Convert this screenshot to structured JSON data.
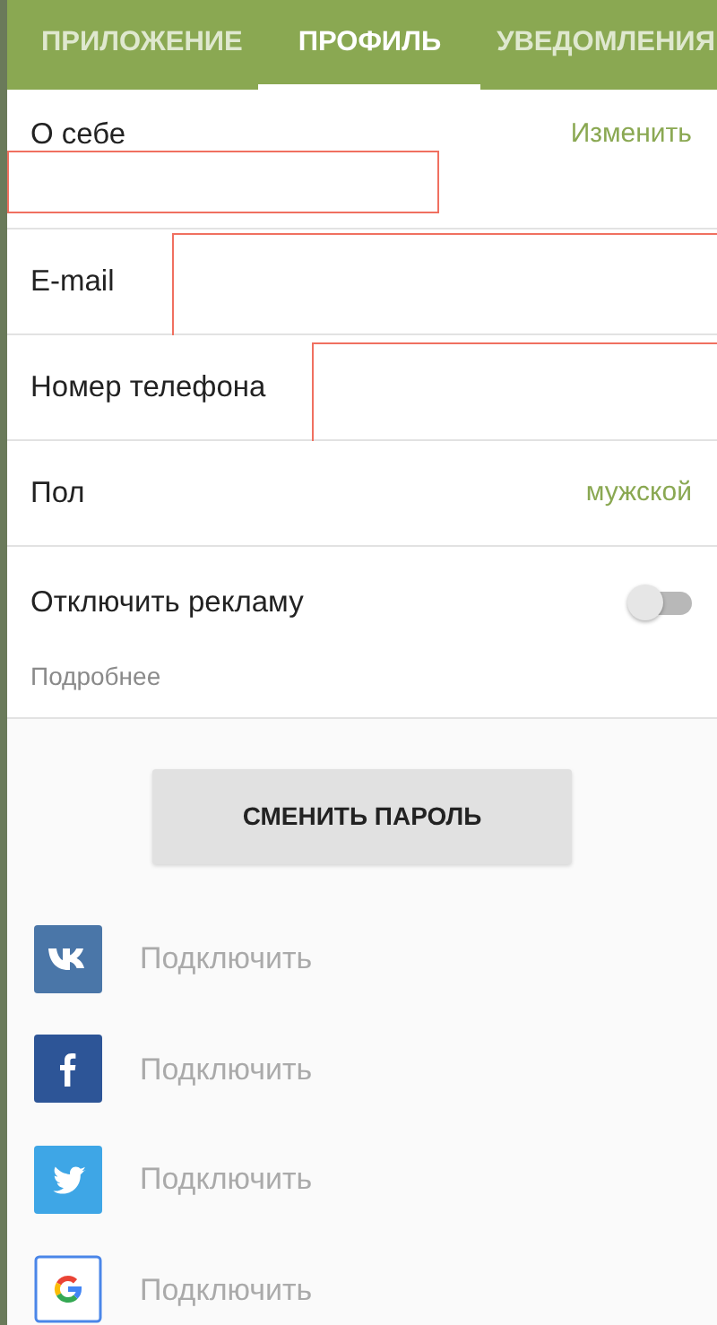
{
  "tabs": [
    {
      "label": "ПРИЛОЖЕНИЕ",
      "selected": false
    },
    {
      "label": "ПРОФИЛЬ",
      "selected": true
    },
    {
      "label": "УВЕДОМЛЕНИЯ",
      "selected": false
    }
  ],
  "profile_rows": [
    {
      "kind": "action",
      "label": "О себе",
      "action": "Изменить",
      "marked": true
    },
    {
      "kind": "plain",
      "label": "E-mail",
      "marked": true
    },
    {
      "kind": "plain",
      "label": "Номер телефона",
      "marked": true
    },
    {
      "kind": "value",
      "label": "Пол",
      "value": "мужской"
    },
    {
      "kind": "toggle",
      "label": "Отключить рекламу",
      "on": false,
      "note": "Подробнее"
    }
  ],
  "change_password_button": "СМЕНИТЬ ПАРОЛЬ",
  "social": [
    {
      "kind": "vk",
      "label": "Подключить"
    },
    {
      "kind": "facebook",
      "label": "Подключить"
    },
    {
      "kind": "twitter",
      "label": "Подключить"
    },
    {
      "kind": "google",
      "label": "Подключить"
    }
  ]
}
